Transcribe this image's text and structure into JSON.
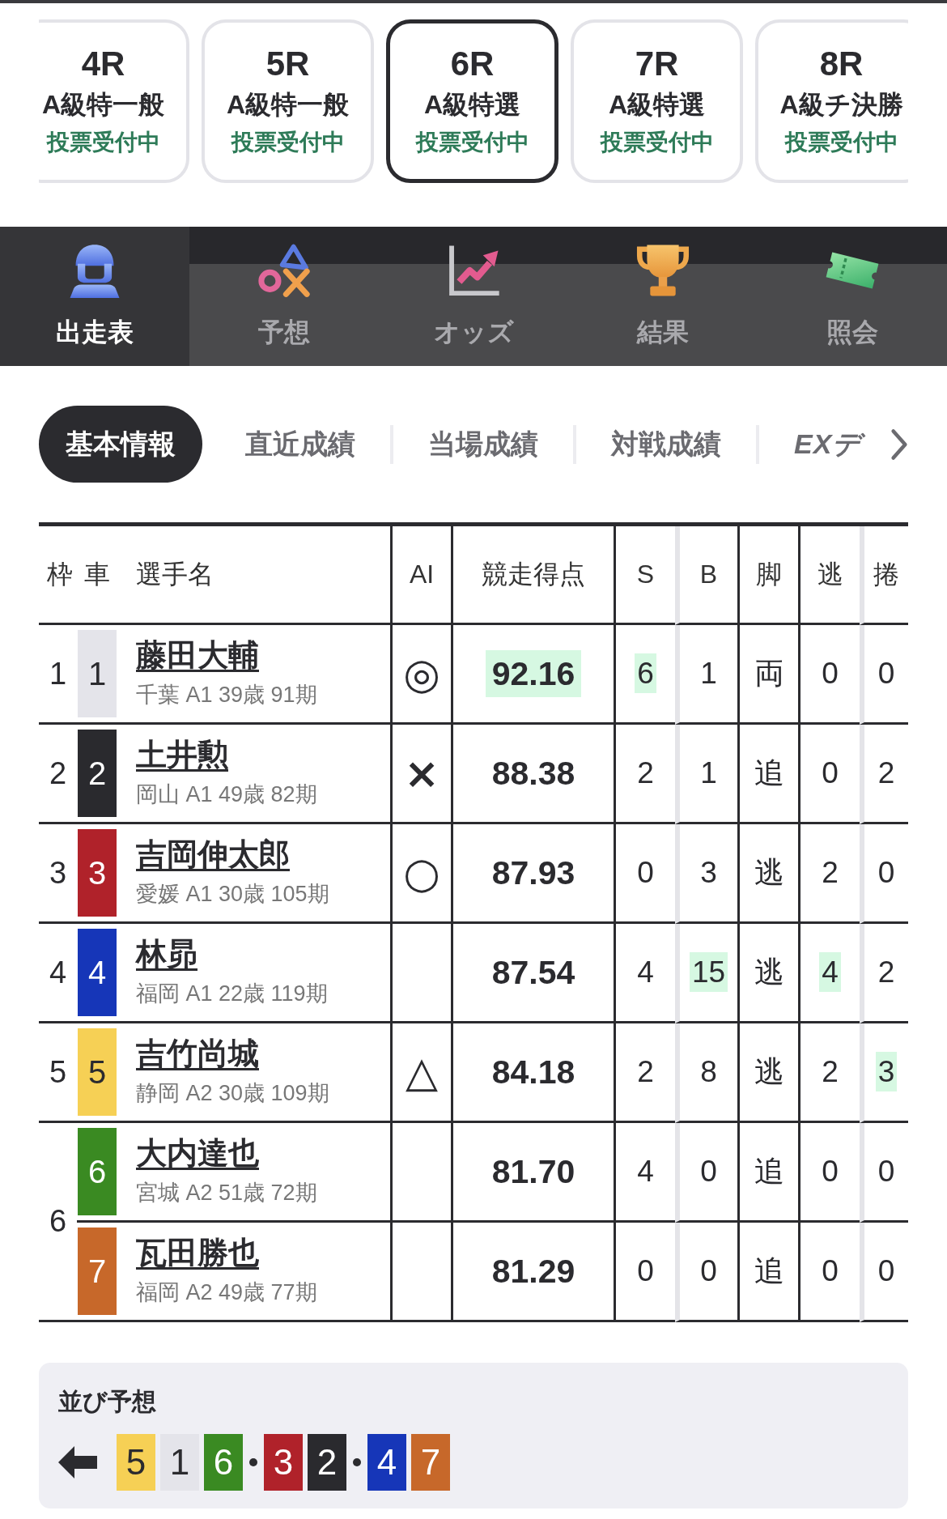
{
  "race_tabs": [
    {
      "race": "4R",
      "class": "A級特一般",
      "status": "投票受付中",
      "selected": false
    },
    {
      "race": "5R",
      "class": "A級特一般",
      "status": "投票受付中",
      "selected": false
    },
    {
      "race": "6R",
      "class": "A級特選",
      "status": "投票受付中",
      "selected": true
    },
    {
      "race": "7R",
      "class": "A級特選",
      "status": "投票受付中",
      "selected": false
    },
    {
      "race": "8R",
      "class": "A級チ決勝",
      "status": "投票受付中",
      "selected": false
    }
  ],
  "nav_tabs": [
    {
      "label": "出走表",
      "selected": true
    },
    {
      "label": "予想",
      "selected": false
    },
    {
      "label": "オッズ",
      "selected": false
    },
    {
      "label": "結果",
      "selected": false
    },
    {
      "label": "照会",
      "selected": false
    }
  ],
  "info_tabs": [
    {
      "label": "基本情報",
      "selected": true,
      "kind": "text"
    },
    {
      "label": "直近成績",
      "selected": false,
      "kind": "text"
    },
    {
      "label": "当場成績",
      "selected": false,
      "kind": "text"
    },
    {
      "label": "対戦成績",
      "selected": false,
      "kind": "text"
    },
    {
      "label": "EXデ",
      "selected": false,
      "kind": "logo"
    }
  ],
  "entry_table": {
    "columns": [
      "枠",
      "車",
      "選手名",
      "AI",
      "競走得点",
      "S",
      "B",
      "脚",
      "逃",
      "捲"
    ],
    "frames": [
      {
        "frame": "1",
        "riders": [
          {
            "car": "1",
            "color": "#e4e4ea",
            "name": "藤田大輔",
            "profile": "千葉 A1 39歳 91期",
            "ai_mark": "◎",
            "cells": [
              {
                "text": "92.16",
                "highlighted": true
              },
              {
                "text": "6",
                "highlighted": true
              },
              {
                "text": "1",
                "highlighted": false
              },
              {
                "text": "両",
                "highlighted": false
              },
              {
                "text": "0",
                "highlighted": false
              },
              {
                "text": "0",
                "highlighted": false
              }
            ]
          }
        ]
      },
      {
        "frame": "2",
        "riders": [
          {
            "car": "2",
            "color": "#2a2a2e",
            "name": "土井勲",
            "profile": "岡山 A1 49歳 82期",
            "ai_mark": "×",
            "cells": [
              {
                "text": "88.38",
                "highlighted": false
              },
              {
                "text": "2",
                "highlighted": false
              },
              {
                "text": "1",
                "highlighted": false
              },
              {
                "text": "追",
                "highlighted": false
              },
              {
                "text": "0",
                "highlighted": false
              },
              {
                "text": "2",
                "highlighted": false
              }
            ]
          }
        ]
      },
      {
        "frame": "3",
        "riders": [
          {
            "car": "3",
            "color": "#b0222a",
            "name": "吉岡伸太郎",
            "profile": "愛媛 A1 30歳 105期",
            "ai_mark": "○",
            "cells": [
              {
                "text": "87.93",
                "highlighted": false
              },
              {
                "text": "0",
                "highlighted": false
              },
              {
                "text": "3",
                "highlighted": false
              },
              {
                "text": "逃",
                "highlighted": false
              },
              {
                "text": "2",
                "highlighted": false
              },
              {
                "text": "0",
                "highlighted": false
              }
            ]
          }
        ]
      },
      {
        "frame": "4",
        "riders": [
          {
            "car": "4",
            "color": "#1636b8",
            "name": "林昴",
            "profile": "福岡 A1 22歳 119期",
            "cells": [
              {
                "text": "87.54",
                "highlighted": false
              },
              {
                "text": "4",
                "highlighted": false
              },
              {
                "text": "15",
                "highlighted": true
              },
              {
                "text": "逃",
                "highlighted": false
              },
              {
                "text": "4",
                "highlighted": true
              },
              {
                "text": "2",
                "highlighted": false
              }
            ]
          }
        ]
      },
      {
        "frame": "5",
        "riders": [
          {
            "car": "5",
            "color": "#f6d055",
            "name": "吉竹尚城",
            "profile": "静岡 A2 30歳 109期",
            "ai_mark": "△",
            "cells": [
              {
                "text": "84.18",
                "highlighted": false
              },
              {
                "text": "2",
                "highlighted": false
              },
              {
                "text": "8",
                "highlighted": false
              },
              {
                "text": "逃",
                "highlighted": false
              },
              {
                "text": "2",
                "highlighted": false
              },
              {
                "text": "3",
                "highlighted": true
              }
            ]
          }
        ]
      },
      {
        "frame": "6",
        "riders": [
          {
            "car": "6",
            "color": "#3a8a22",
            "name": "大内達也",
            "profile": "宮城 A2 51歳 72期",
            "cells": [
              {
                "text": "81.70",
                "highlighted": false
              },
              {
                "text": "4",
                "highlighted": false
              },
              {
                "text": "0",
                "highlighted": false
              },
              {
                "text": "追",
                "highlighted": false
              },
              {
                "text": "0",
                "highlighted": false
              },
              {
                "text": "0",
                "highlighted": false
              }
            ]
          },
          {
            "car": "7",
            "color": "#c7682a",
            "name": "瓦田勝也",
            "profile": "福岡 A2 49歳 77期",
            "cells": [
              {
                "text": "81.29",
                "highlighted": false
              },
              {
                "text": "0",
                "highlighted": false
              },
              {
                "text": "0",
                "highlighted": false
              },
              {
                "text": "追",
                "highlighted": false
              },
              {
                "text": "0",
                "highlighted": false
              },
              {
                "text": "0",
                "highlighted": false
              }
            ]
          }
        ]
      }
    ]
  },
  "lineup": {
    "title": "並び予想",
    "groups": [
      {
        "cars": [
          {
            "car": "5",
            "color": "#f6d055"
          },
          {
            "car": "1",
            "color": "#e4e4ea"
          },
          {
            "car": "6",
            "color": "#3a8a22"
          }
        ]
      },
      {
        "cars": [
          {
            "car": "3",
            "color": "#b0222a"
          },
          {
            "car": "2",
            "color": "#2a2a2e"
          }
        ]
      },
      {
        "cars": [
          {
            "car": "4",
            "color": "#1636b8"
          },
          {
            "car": "7",
            "color": "#c7682a"
          }
        ]
      }
    ]
  }
}
